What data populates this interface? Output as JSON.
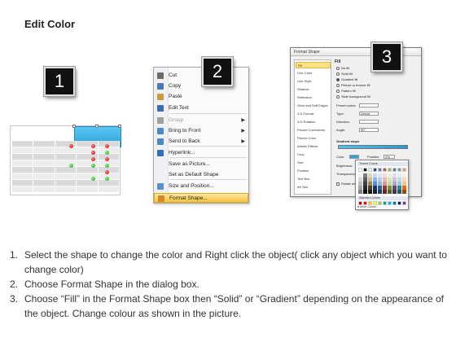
{
  "heading": "Edit Color",
  "badges": [
    "1",
    "2",
    "3"
  ],
  "menu": {
    "items": [
      {
        "label": "Cut",
        "icon": "scissors-icon",
        "color": "#6b6b6b",
        "disabled": false,
        "submenu": false
      },
      {
        "label": "Copy",
        "icon": "copy-icon",
        "color": "#4a78b8",
        "disabled": false,
        "submenu": false
      },
      {
        "label": "Paste",
        "icon": "paste-icon",
        "color": "#c99b3c",
        "disabled": false,
        "submenu": false
      },
      {
        "label": "Edit Text",
        "icon": "edit-text-icon",
        "color": "#3b6cb5",
        "disabled": false,
        "submenu": false
      },
      {
        "label": "Group",
        "icon": "group-icon",
        "color": "#a0a0a0",
        "disabled": true,
        "submenu": true
      },
      {
        "label": "Bring to Front",
        "icon": "bring-to-front-icon",
        "color": "#4a88c8",
        "disabled": false,
        "submenu": true
      },
      {
        "label": "Send to Back",
        "icon": "send-to-back-icon",
        "color": "#4a88c8",
        "disabled": false,
        "submenu": true
      },
      {
        "label": "Hyperlink...",
        "icon": "hyperlink-icon",
        "color": "#2f6fb3",
        "disabled": false,
        "submenu": false
      },
      {
        "label": "Save as Picture...",
        "icon": "",
        "color": "",
        "disabled": false,
        "submenu": false
      },
      {
        "label": "Set as Default Shape",
        "icon": "",
        "color": "",
        "disabled": false,
        "submenu": false
      },
      {
        "label": "Size and Position...",
        "icon": "size-position-icon",
        "color": "#5a8fcf",
        "disabled": false,
        "submenu": false
      },
      {
        "label": "Format Shape...",
        "icon": "format-shape-icon",
        "color": "#d08a2a",
        "disabled": false,
        "submenu": false,
        "highlight": true
      }
    ]
  },
  "dialog": {
    "title": "Format Shape",
    "categories": [
      "Fill",
      "Line Color",
      "Line Style",
      "Shadow",
      "Reflection",
      "Glow and Soft Edges",
      "3-D Format",
      "3-D Rotation",
      "Picture Corrections",
      "Picture Color",
      "Artistic Effects",
      "Crop",
      "Size",
      "Position",
      "Text Box",
      "Alt Text"
    ],
    "selected_category": "Fill",
    "pane_title": "Fill",
    "fill_options": [
      "No fill",
      "Solid fill",
      "Gradient fill",
      "Picture or texture fill",
      "Pattern fill",
      "Slide background fill"
    ],
    "selected_fill": "Gradient fill",
    "props": [
      {
        "label": "Preset colors:",
        "value": ""
      },
      {
        "label": "Type:",
        "value": "Linear"
      },
      {
        "label": "Direction:",
        "value": ""
      },
      {
        "label": "Angle:",
        "value": "90°"
      }
    ],
    "gradient_stops_label": "Gradient stops",
    "color_label": "Color",
    "position_label": "Position:",
    "position_value": "0%",
    "brightness_label": "Brightness:",
    "transparency_label": "Transparency:",
    "rotate_label": "Rotate with shape"
  },
  "palette": {
    "theme_label": "Theme Colors",
    "standard_label": "Standard Colors",
    "more_label": "More Colors...",
    "theme_colors": [
      "#ffffff",
      "#000000",
      "#eeece1",
      "#1f497d",
      "#4f81bd",
      "#c0504d",
      "#9bbb59",
      "#8064a2",
      "#4bacc6",
      "#f79646"
    ],
    "theme_shades": [
      [
        "#f2f2f2",
        "#7f7f7f",
        "#ddd9c3",
        "#c6d9f0",
        "#dbe5f1",
        "#f2dcdb",
        "#ebf1dd",
        "#e5e0ec",
        "#dbeef3",
        "#fdeada"
      ],
      [
        "#d8d8d8",
        "#595959",
        "#c4bd97",
        "#8db3e2",
        "#b8cce4",
        "#e5b9b7",
        "#d7e3bc",
        "#ccc1d9",
        "#b7dde8",
        "#fbd5b5"
      ],
      [
        "#bfbfbf",
        "#3f3f3f",
        "#938953",
        "#548dd4",
        "#95b3d7",
        "#d99694",
        "#c3d69b",
        "#b2a2c7",
        "#92cddc",
        "#fac08f"
      ],
      [
        "#a5a5a5",
        "#262626",
        "#494429",
        "#17365d",
        "#366092",
        "#953734",
        "#76923c",
        "#5f497a",
        "#31859b",
        "#e36c09"
      ],
      [
        "#7f7f7f",
        "#0c0c0c",
        "#1d1b10",
        "#0f243e",
        "#244061",
        "#632423",
        "#4f6128",
        "#3f3151",
        "#205867",
        "#974806"
      ]
    ],
    "standard_colors": [
      "#c00000",
      "#ff0000",
      "#ffc000",
      "#ffff00",
      "#92d050",
      "#00b050",
      "#00b0f0",
      "#0070c0",
      "#002060",
      "#7030a0"
    ]
  },
  "instructions": [
    {
      "num": "1.",
      "text": "Select the shape to change the color and Right click the object( click any object which you want to change color)"
    },
    {
      "num": "2.",
      "text": "Choose Format Shape in the dialog box."
    },
    {
      "num": "3.",
      "text": "Choose “Fill” in the Format Shape box then “Solid” or “Gradient” depending on the appearance of the object. Change colour as shown in the picture."
    }
  ]
}
